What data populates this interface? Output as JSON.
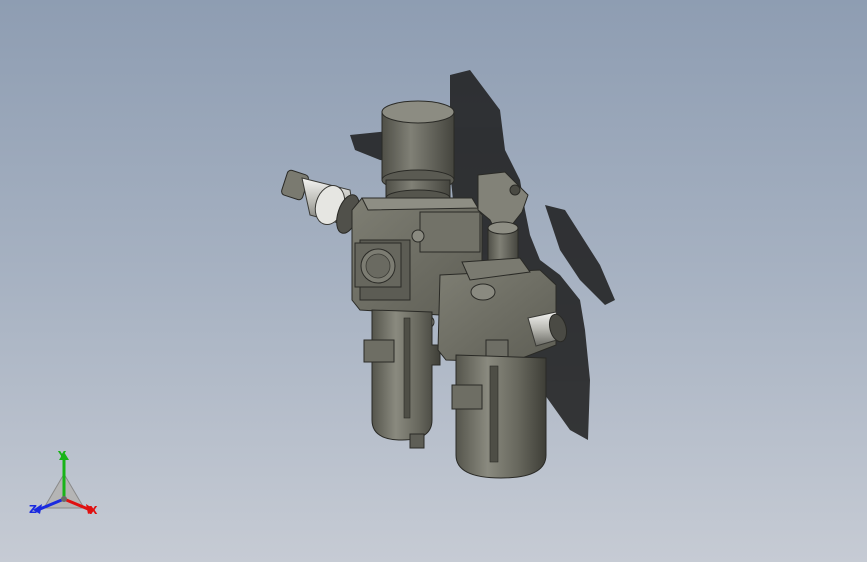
{
  "viewport": {
    "background_top": "#8e9db2",
    "background_bottom": "#c6cbd4"
  },
  "model": {
    "body_color": "#6d6d63",
    "shadow_color": "#1c1c1c",
    "metal_color": "#d4d4d0"
  },
  "triad": {
    "x_label": "X",
    "y_label": "Y",
    "z_label": "Z",
    "x_color": "#e01010",
    "y_color": "#18b418",
    "z_color": "#1a2ae0"
  }
}
